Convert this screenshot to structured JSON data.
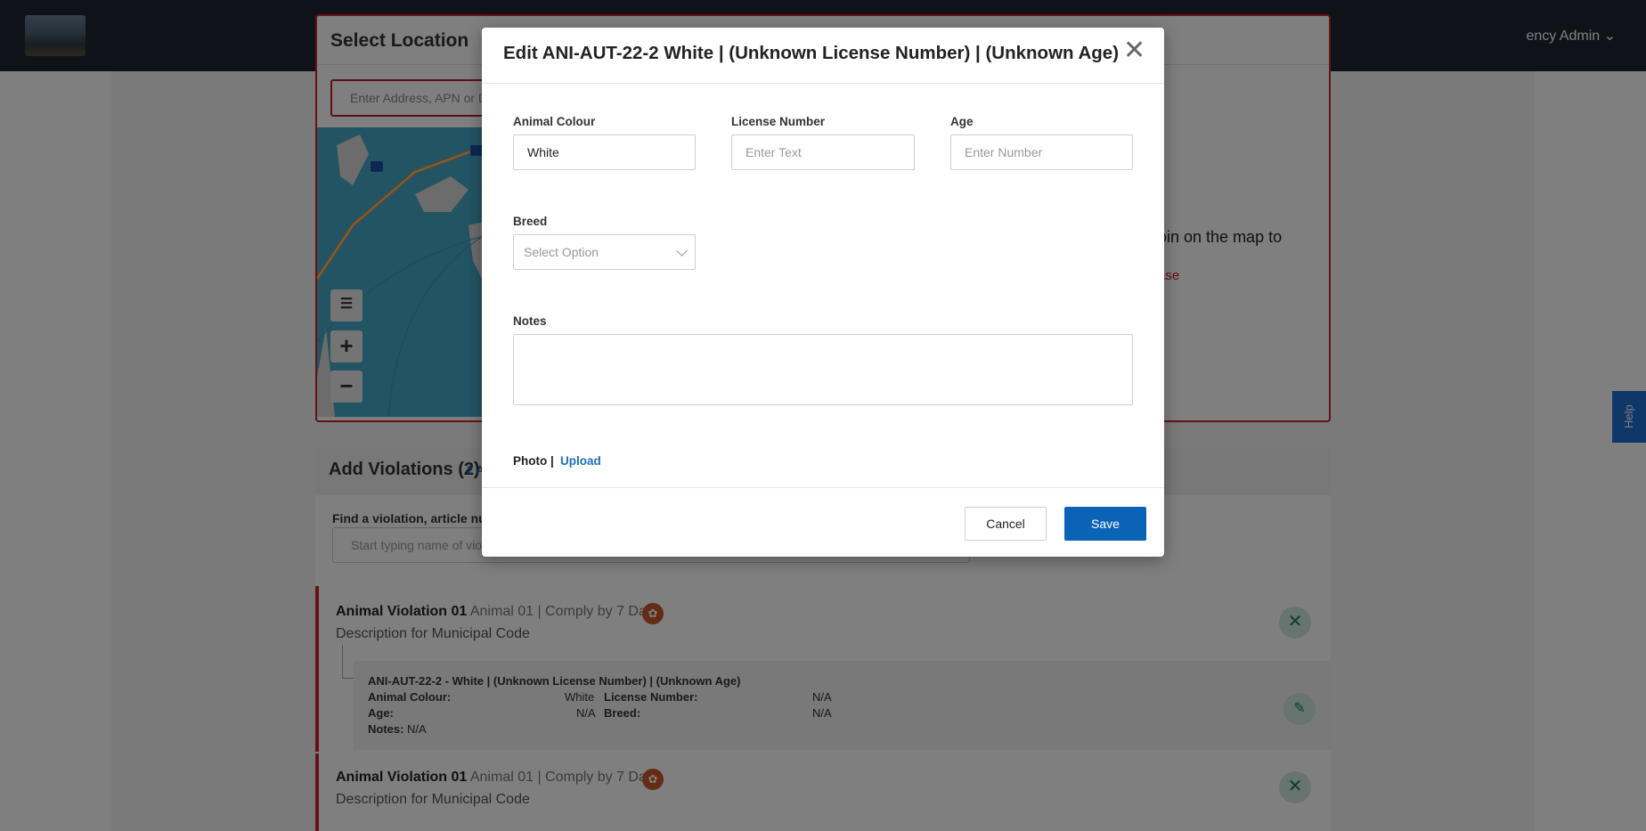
{
  "header": {
    "agency_label": "ency Admin ⌄"
  },
  "location": {
    "title": "Select Location",
    "address_placeholder": "Enter Address, APN or Dr",
    "map_hint": "oin on the map to",
    "map_hint_link": "ase"
  },
  "violations": {
    "title": "Add Violations (2)",
    "count_link": "2 A",
    "find_label": "Find a violation, article num",
    "find_placeholder": "Start typing name of viol",
    "items": [
      {
        "name": "Animal Violation 01",
        "meta": "Animal 01 | Comply by 7 Days",
        "description": "Description for Municipal Code"
      },
      {
        "name": "Animal Violation 01",
        "meta": "Animal 01 | Comply by 7 Days",
        "description": "Description for Municipal Code"
      }
    ],
    "animal": {
      "title": "ANI-AUT-22-2 - White | (Unknown License Number) | (Unknown Age)",
      "colour_label": "Animal Colour:",
      "colour_value": "White",
      "license_label": "License Number:",
      "license_value": "N/A",
      "age_label": "Age:",
      "age_value": "N/A",
      "breed_label": "Breed:",
      "breed_value": "N/A",
      "notes_label": "Notes:",
      "notes_value": "N/A"
    }
  },
  "help_label": "Help",
  "modal": {
    "title": "Edit ANI-AUT-22-2 White | (Unknown License Number) | (Unknown Age)",
    "colour_label": "Animal Colour",
    "colour_value": "White",
    "license_label": "License Number",
    "license_placeholder": "Enter Text",
    "age_label": "Age",
    "age_placeholder": "Enter Number",
    "breed_label": "Breed",
    "breed_placeholder": "Select Option",
    "notes_label": "Notes",
    "photo_label": "Photo |",
    "upload_label": "Upload",
    "cancel_label": "Cancel",
    "save_label": "Save"
  },
  "icons": {
    "close": "close-icon",
    "layers": "layers-icon",
    "zoom_in": "plus-icon",
    "zoom_out": "minus-icon",
    "paw": "paw-icon",
    "remove": "x-icon",
    "edit": "pencil-icon"
  },
  "colors": {
    "accent": "#0b63b8",
    "danger": "#d0232b",
    "overlay": "rgba(0,0,0,0.5)"
  }
}
